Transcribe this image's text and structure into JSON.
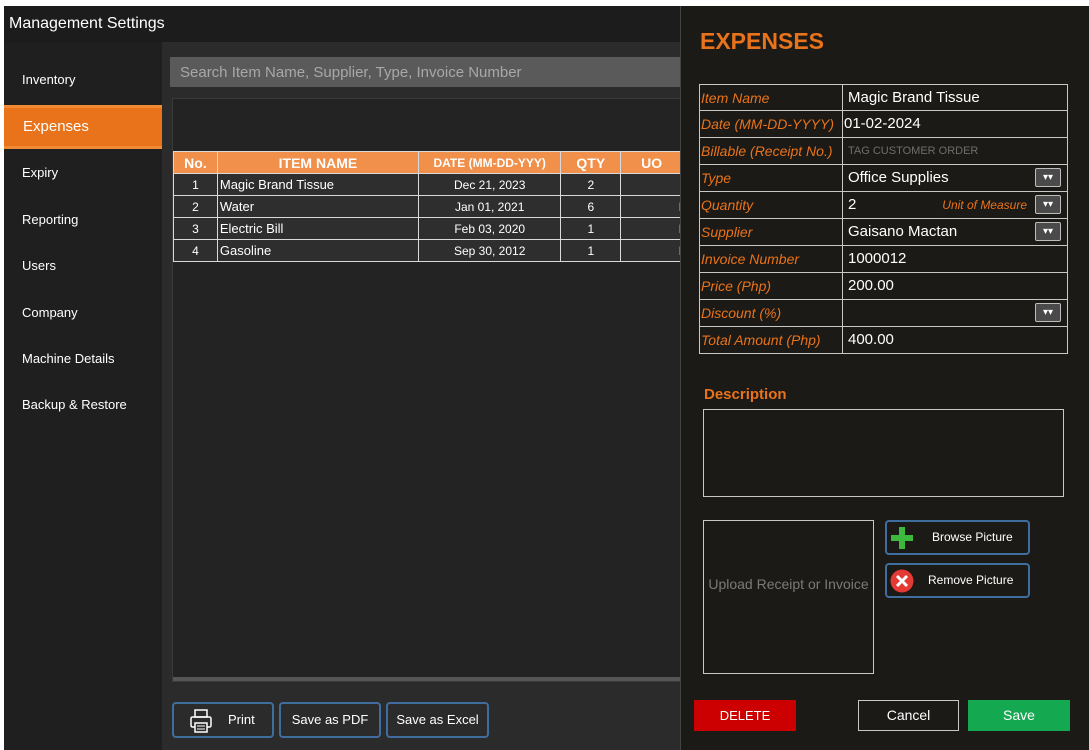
{
  "window": {
    "title": "Management Settings"
  },
  "sidebar": {
    "items": [
      {
        "label": "Inventory"
      },
      {
        "label": "Expenses",
        "active": true
      },
      {
        "label": "Expiry"
      },
      {
        "label": "Reporting"
      },
      {
        "label": "Users"
      },
      {
        "label": "Company"
      },
      {
        "label": "Machine Details"
      },
      {
        "label": "Backup & Restore"
      }
    ]
  },
  "search": {
    "placeholder": "Search Item Name, Supplier, Type, Invoice Number"
  },
  "table": {
    "headers": [
      "No.",
      "ITEM NAME",
      "DATE (MM-DD-YYY)",
      "QTY",
      "UO"
    ],
    "rows": [
      {
        "no": "1",
        "item": "Magic Brand Tissue",
        "date": "Dec 21, 2023",
        "qty": "2",
        "uom": ""
      },
      {
        "no": "2",
        "item": "Water",
        "date": "Jan 01, 2021",
        "qty": "6",
        "uom": "I"
      },
      {
        "no": "3",
        "item": "Electric Bill",
        "date": "Feb 03, 2020",
        "qty": "1",
        "uom": "I"
      },
      {
        "no": "4",
        "item": "Gasoline",
        "date": "Sep 30, 2012",
        "qty": "1",
        "uom": "I"
      }
    ]
  },
  "actions": {
    "print": "Print",
    "pdf": "Save as PDF",
    "excel": "Save as Excel"
  },
  "panel": {
    "title": "EXPENSES",
    "fields": {
      "item_name": {
        "label": "Item Name",
        "value": "Magic Brand Tissue"
      },
      "date": {
        "label": "Date (MM-DD-YYYY)",
        "value": "01-02-2024"
      },
      "billable": {
        "label": "Billable (Receipt No.)",
        "placeholder": "TAG CUSTOMER ORDER"
      },
      "type": {
        "label": "Type",
        "value": "Office Supplies"
      },
      "quantity": {
        "label": "Quantity",
        "value": "2",
        "uom_label": "Unit of Measure"
      },
      "supplier": {
        "label": "Supplier",
        "value": "Gaisano Mactan"
      },
      "invoice": {
        "label": "Invoice Number",
        "value": "1000012"
      },
      "price": {
        "label": "Price (Php)",
        "value": "200.00"
      },
      "discount": {
        "label": "Discount (%)",
        "value": ""
      },
      "total": {
        "label": "Total Amount (Php)",
        "value": "400.00"
      }
    },
    "description_label": "Description",
    "upload_text": "Upload Receipt or Invoice",
    "browse": "Browse Picture",
    "remove": "Remove Picture",
    "delete": "DELETE",
    "cancel": "Cancel",
    "save": "Save"
  },
  "colors": {
    "accent": "#e8731a",
    "header": "#f0904a",
    "delete": "#cc0000",
    "save": "#14a850"
  }
}
